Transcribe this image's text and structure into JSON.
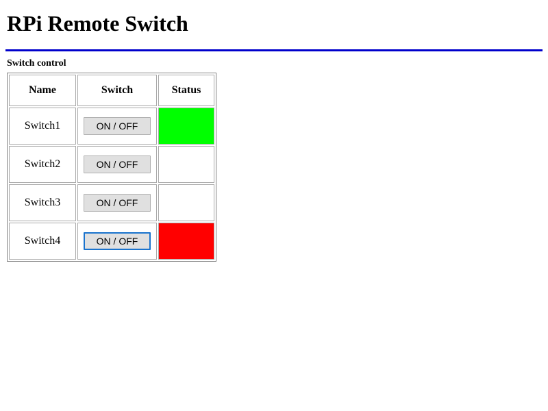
{
  "page": {
    "title": "RPi Remote Switch",
    "section_heading": "Switch control"
  },
  "table": {
    "headers": {
      "name": "Name",
      "switch": "Switch",
      "status": "Status"
    },
    "rows": [
      {
        "name": "Switch1",
        "button_label": "ON / OFF",
        "status_color": "#00ff00",
        "status_state": "on",
        "focused": false
      },
      {
        "name": "Switch2",
        "button_label": "ON / OFF",
        "status_color": "#ffffff",
        "status_state": "blank",
        "focused": false
      },
      {
        "name": "Switch3",
        "button_label": "ON / OFF",
        "status_color": "#ffffff",
        "status_state": "blank",
        "focused": false
      },
      {
        "name": "Switch4",
        "button_label": "ON / OFF",
        "status_color": "#ff0000",
        "status_state": "off",
        "focused": true
      }
    ]
  },
  "colors": {
    "divider": "#0000cc",
    "status_on": "#00ff00",
    "status_off": "#ff0000",
    "button_face": "#e0e0e0",
    "focus_ring": "#1a73cd",
    "table_border": "#a8a8a8"
  }
}
